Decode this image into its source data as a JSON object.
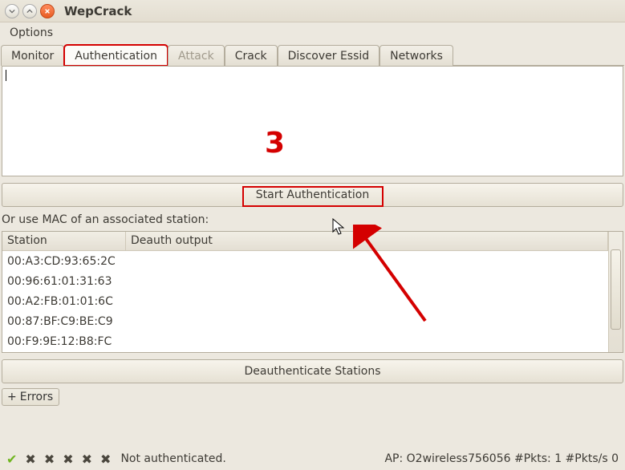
{
  "window": {
    "title": "WepCrack"
  },
  "menu": {
    "options": "Options"
  },
  "tabs": {
    "monitor": "Monitor",
    "authentication": "Authentication",
    "attack": "Attack",
    "crack": "Crack",
    "discover_essid": "Discover Essid",
    "networks": "Networks"
  },
  "auth_output": {
    "text": ""
  },
  "buttons": {
    "start_auth": "Start Authentication",
    "deauth": "Deauthenticate Stations"
  },
  "labels": {
    "or_use_mac": "Or use MAC of an associated station:"
  },
  "table": {
    "headers": {
      "station": "Station",
      "deauth_output": "Deauth output"
    },
    "rows": [
      {
        "station": "00:A3:CD:93:65:2C",
        "deauth": ""
      },
      {
        "station": "00:96:61:01:31:63",
        "deauth": ""
      },
      {
        "station": "00:A2:FB:01:01:6C",
        "deauth": ""
      },
      {
        "station": "00:87:BF:C9:BE:C9",
        "deauth": ""
      },
      {
        "station": "00:F9:9E:12:B8:FC",
        "deauth": ""
      }
    ]
  },
  "expander": {
    "errors": "Errors"
  },
  "status": {
    "message": "Not authenticated.",
    "right": "AP: O2wireless756056 #Pkts: 1 #Pkts/s 0"
  },
  "annotations": {
    "number": "3"
  }
}
